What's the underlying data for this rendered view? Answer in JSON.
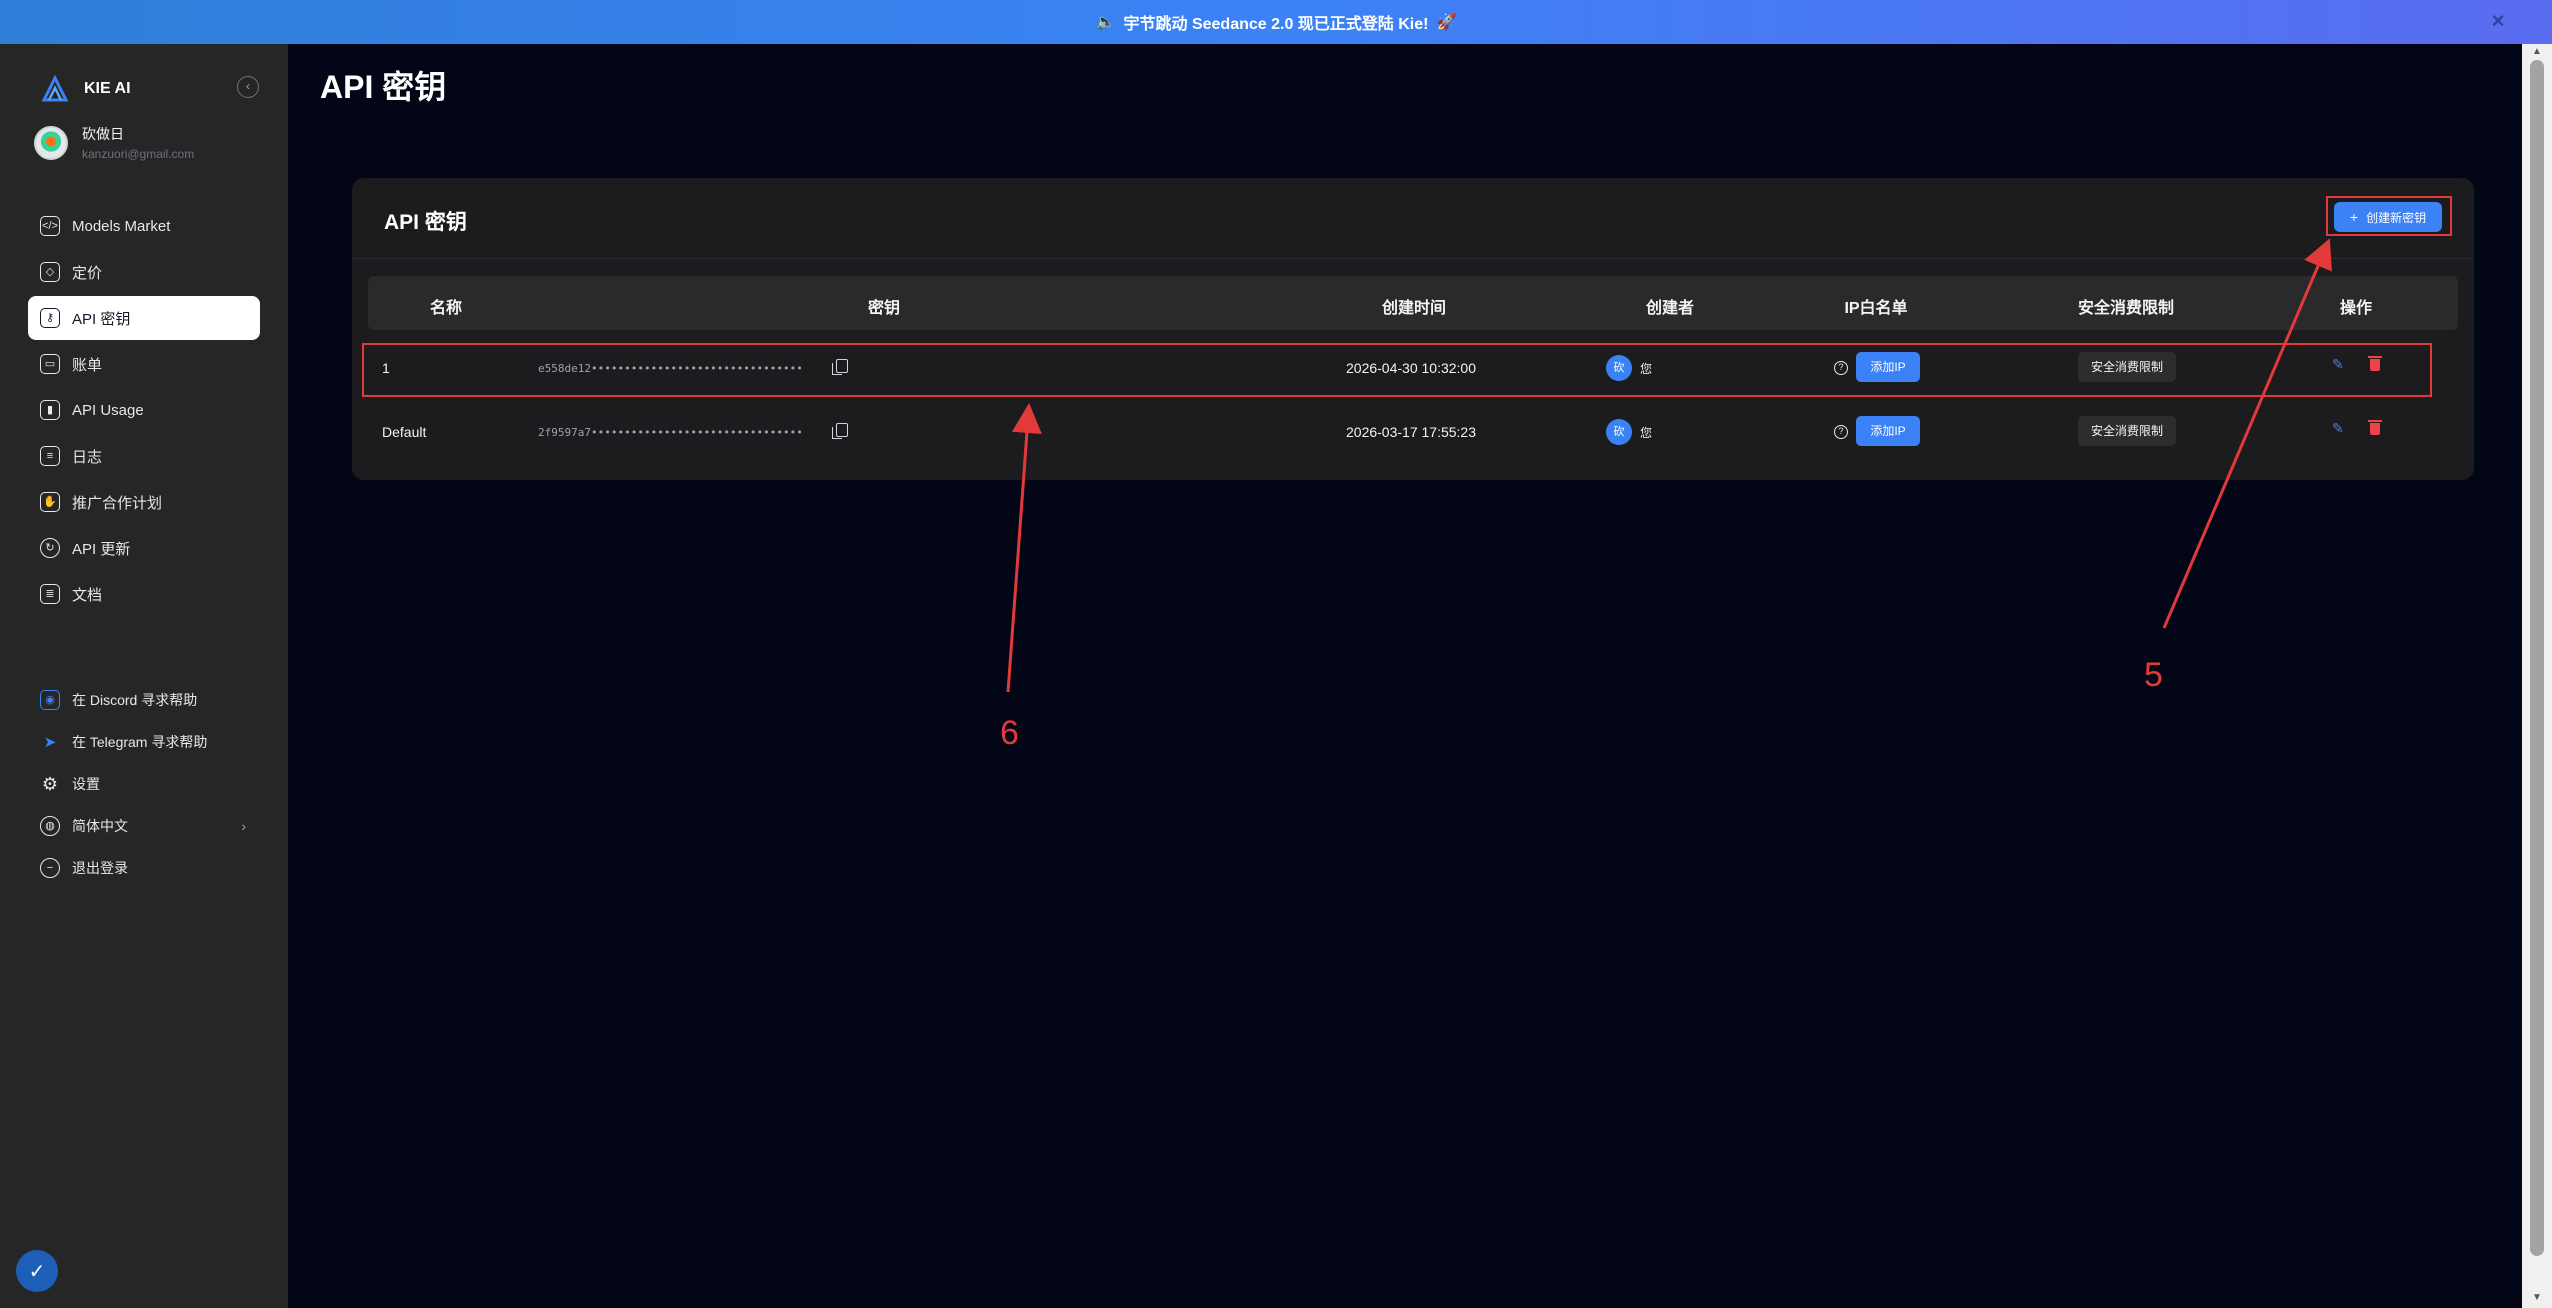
{
  "banner": {
    "text": "宇节跳动 Seedance 2.0 现已正式登陆 Kie!",
    "icon": "megaphone-icon",
    "rocket": "🚀",
    "close": "×"
  },
  "sidebar": {
    "brand": "KIE AI",
    "collapse": "‹",
    "user": {
      "name": "砍做日",
      "email": "kanzuori@gmail.com"
    },
    "items": [
      {
        "label": "Models Market",
        "icon": "code-icon",
        "glyph": "</>"
      },
      {
        "label": "定价",
        "icon": "tag-icon",
        "glyph": "◇"
      },
      {
        "label": "API 密钥",
        "icon": "key-icon",
        "glyph": "⚷"
      },
      {
        "label": "账单",
        "icon": "card-icon",
        "glyph": "▭"
      },
      {
        "label": "API Usage",
        "icon": "chart-icon",
        "glyph": "▮"
      },
      {
        "label": "日志",
        "icon": "log-icon",
        "glyph": "≡"
      },
      {
        "label": "推广合作计划",
        "icon": "handshake-icon",
        "glyph": "✋"
      },
      {
        "label": "API 更新",
        "icon": "refresh-icon",
        "glyph": "↻"
      },
      {
        "label": "文档",
        "icon": "doc-icon",
        "glyph": "≣"
      }
    ],
    "secondary": [
      {
        "label": "在 Discord 寻求帮助",
        "icon": "discord-icon",
        "glyph": "◉"
      },
      {
        "label": "在 Telegram 寻求帮助",
        "icon": "telegram-icon",
        "glyph": "➤"
      },
      {
        "label": "设置",
        "icon": "gear-icon",
        "glyph": "⚙"
      },
      {
        "label": "简体中文",
        "icon": "globe-icon",
        "glyph": "◍",
        "chevron": "›"
      },
      {
        "label": "退出登录",
        "icon": "logout-icon",
        "glyph": "−"
      }
    ],
    "cookie_glyph": "✓"
  },
  "main": {
    "page_title": "API 密钥",
    "card_title": "API 密钥",
    "create_button": "创建新密钥",
    "create_plus": "+",
    "columns": [
      "名称",
      "密钥",
      "创建时间",
      "创建者",
      "IP白名单",
      "安全消费限制",
      "操作"
    ],
    "rows": [
      {
        "name": "1",
        "key": "e558de12••••••••••••••••••••••••••••••••",
        "created": "2026-04-30 10:32:00",
        "creator_badge": "砍",
        "creator_label": "您",
        "add_ip": "添加IP",
        "limit": "安全消费限制"
      },
      {
        "name": "Default",
        "key": "2f9597a7••••••••••••••••••••••••••••••••",
        "created": "2026-03-17 17:55:23",
        "creator_badge": "砍",
        "creator_label": "您",
        "add_ip": "添加IP",
        "limit": "安全消费限制"
      }
    ],
    "help_glyph": "?",
    "edit_glyph": "✎"
  },
  "annotations": {
    "label_5": "5",
    "label_6": "6"
  },
  "colors": {
    "accent": "#3b82f6",
    "annotation": "#e23a3a",
    "danger": "#ef4444"
  }
}
